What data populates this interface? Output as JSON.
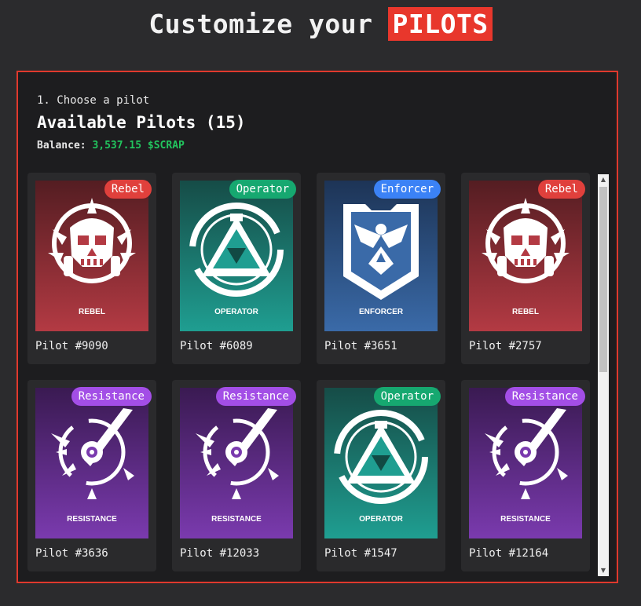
{
  "header": {
    "title_prefix": "Customize your",
    "title_highlight": "PILOTS"
  },
  "panel": {
    "step": "1. Choose a pilot",
    "title": "Available Pilots (15)",
    "balance_label": "Balance:",
    "balance_value": "3,537.15 $SCRAP"
  },
  "colors": {
    "accent_red": "#e8372c",
    "balance_green": "#22c55e",
    "rebel_badge": "#e0403c",
    "operator_badge": "#16a870",
    "enforcer_badge": "#3b82f6",
    "resistance_badge": "#a34ee6"
  },
  "pilots": [
    {
      "name": "Pilot #9090",
      "faction": "Rebel",
      "art_label": "REBEL",
      "icon": "rebel-skull-icon"
    },
    {
      "name": "Pilot #6089",
      "faction": "Operator",
      "art_label": "OPERATOR",
      "icon": "operator-triangle-icon"
    },
    {
      "name": "Pilot #3651",
      "faction": "Enforcer",
      "art_label": "ENFORCER",
      "icon": "enforcer-eagle-icon"
    },
    {
      "name": "Pilot #2757",
      "faction": "Rebel",
      "art_label": "REBEL",
      "icon": "rebel-skull-icon"
    },
    {
      "name": "Pilot #3636",
      "faction": "Resistance",
      "art_label": "RESISTANCE",
      "icon": "resistance-blade-icon"
    },
    {
      "name": "Pilot #12033",
      "faction": "Resistance",
      "art_label": "RESISTANCE",
      "icon": "resistance-blade-icon"
    },
    {
      "name": "Pilot #1547",
      "faction": "Operator",
      "art_label": "OPERATOR",
      "icon": "operator-triangle-icon"
    },
    {
      "name": "Pilot #12164",
      "faction": "Resistance",
      "art_label": "RESISTANCE",
      "icon": "resistance-blade-icon"
    }
  ]
}
